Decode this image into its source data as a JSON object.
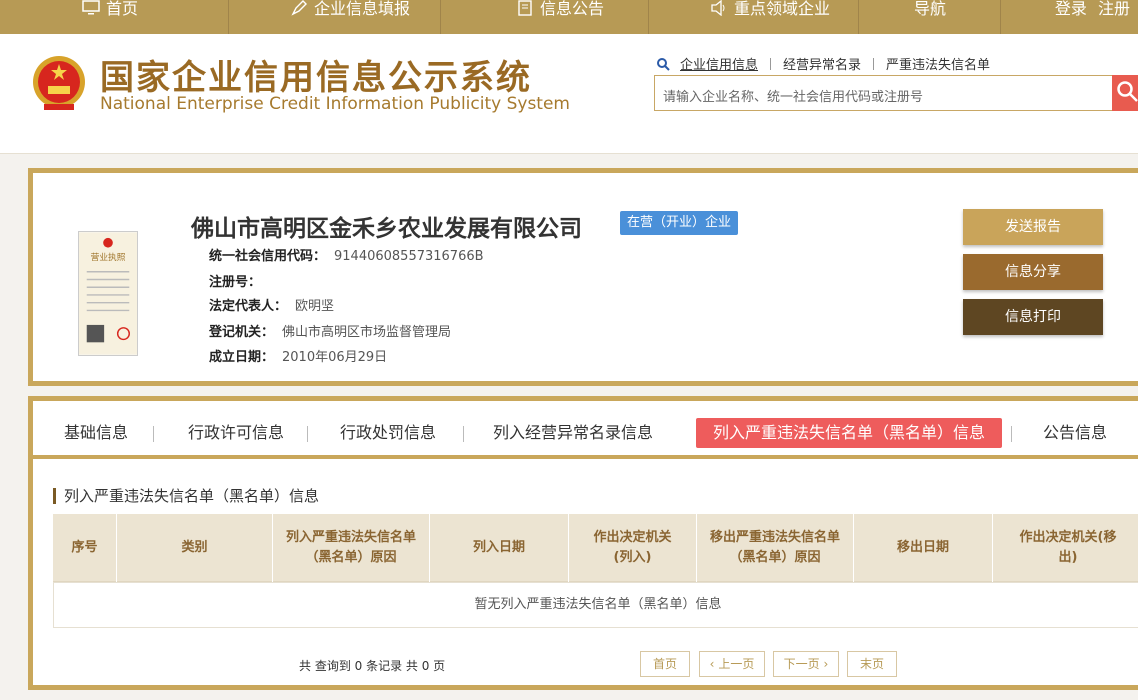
{
  "nav": {
    "items": [
      {
        "label": "首页",
        "icon": "monitor-icon"
      },
      {
        "label": "企业信息填报",
        "icon": "pen-icon"
      },
      {
        "label": "信息公告",
        "icon": "document-icon"
      },
      {
        "label": "重点领域企业",
        "icon": "speaker-icon"
      },
      {
        "label": "导航",
        "icon": ""
      }
    ],
    "login": "登录",
    "register": "注册"
  },
  "header": {
    "title_cn": "国家企业信用信息公示系统",
    "title_en": "National Enterprise Credit Information Publicity System",
    "search_links": [
      "企业信用信息",
      "经营异常名录",
      "严重违法失信名单"
    ],
    "search_placeholder": "请输入企业名称、统一社会信用代码或注册号"
  },
  "company": {
    "name": "佛山市高明区金禾乡农业发展有限公司",
    "status": "在营（开业）企业",
    "license_title": "营业执照",
    "fields": [
      {
        "label": "统一社会信用代码：",
        "value": "91440608557316766B"
      },
      {
        "label": "注册号：",
        "value": ""
      },
      {
        "label": "法定代表人：",
        "value": "欧明坚"
      },
      {
        "label": "登记机关：",
        "value": "佛山市高明区市场监督管理局"
      },
      {
        "label": "成立日期：",
        "value": "2010年06月29日"
      }
    ],
    "buttons": [
      "发送报告",
      "信息分享",
      "信息打印"
    ]
  },
  "tabs": [
    "基础信息",
    "行政许可信息",
    "行政处罚信息",
    "列入经营异常名录信息",
    "列入严重违法失信名单（黑名单）信息",
    "公告信息"
  ],
  "section": {
    "title": "列入严重违法失信名单（黑名单）信息",
    "headers": [
      "序号",
      "类别",
      "列入严重违法失信名单（黑名单）原因",
      "列入日期",
      "作出决定机关(列入)",
      "移出严重违法失信名单（黑名单）原因",
      "移出日期",
      "作出决定机关(移出)"
    ],
    "empty_text": "暂无列入严重违法失信名单（黑名单）信息"
  },
  "pager": {
    "info": "共 查询到 0 条记录 共 0 页",
    "first": "首页",
    "prev": "上一页",
    "next": "下一页",
    "last": "末页"
  },
  "colors": {
    "nav_bg": "#b79a55",
    "title_brown": "#9a6a24",
    "badge_blue": "#4a90d9",
    "active_tab_red": "#ee5c5c",
    "btn_send": "#c9a45a",
    "btn_share": "#9a6a2e",
    "btn_print": "#5e4622"
  }
}
